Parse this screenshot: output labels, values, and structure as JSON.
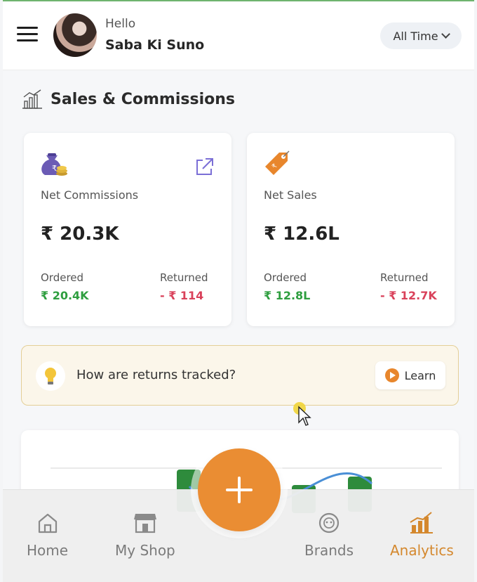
{
  "header": {
    "greeting": "Hello",
    "user_name": "Saba Ki Suno",
    "time_filter": "All Time",
    "avatar_icon": "user-avatar"
  },
  "section": {
    "title": "Sales & Commissions",
    "icon": "bar-chart-icon"
  },
  "cards": [
    {
      "label": "Net Commissions",
      "value": "₹ 20.3K",
      "ordered_label": "Ordered",
      "ordered_value": "₹ 20.4K",
      "returned_label": "Returned",
      "returned_value": "- ₹ 114",
      "icon": "money-bag-icon"
    },
    {
      "label": "Net Sales",
      "value": "₹ 12.6L",
      "ordered_label": "Ordered",
      "ordered_value": "₹ 12.8L",
      "returned_label": "Returned",
      "returned_value": "- ₹ 12.7K",
      "icon": "price-tag-icon"
    }
  ],
  "banner": {
    "question": "How are returns tracked?",
    "learn_label": "Learn"
  },
  "colors": {
    "accent": "#ea8d33",
    "positive": "#2e9e3f",
    "negative": "#d9415a"
  },
  "nav": {
    "items": [
      {
        "label": "Home",
        "icon": "home-icon"
      },
      {
        "label": "My Shop",
        "icon": "shop-icon"
      },
      {
        "label": "Brands",
        "icon": "brands-icon"
      },
      {
        "label": "Analytics",
        "icon": "analytics-icon"
      }
    ],
    "active": "Analytics"
  }
}
